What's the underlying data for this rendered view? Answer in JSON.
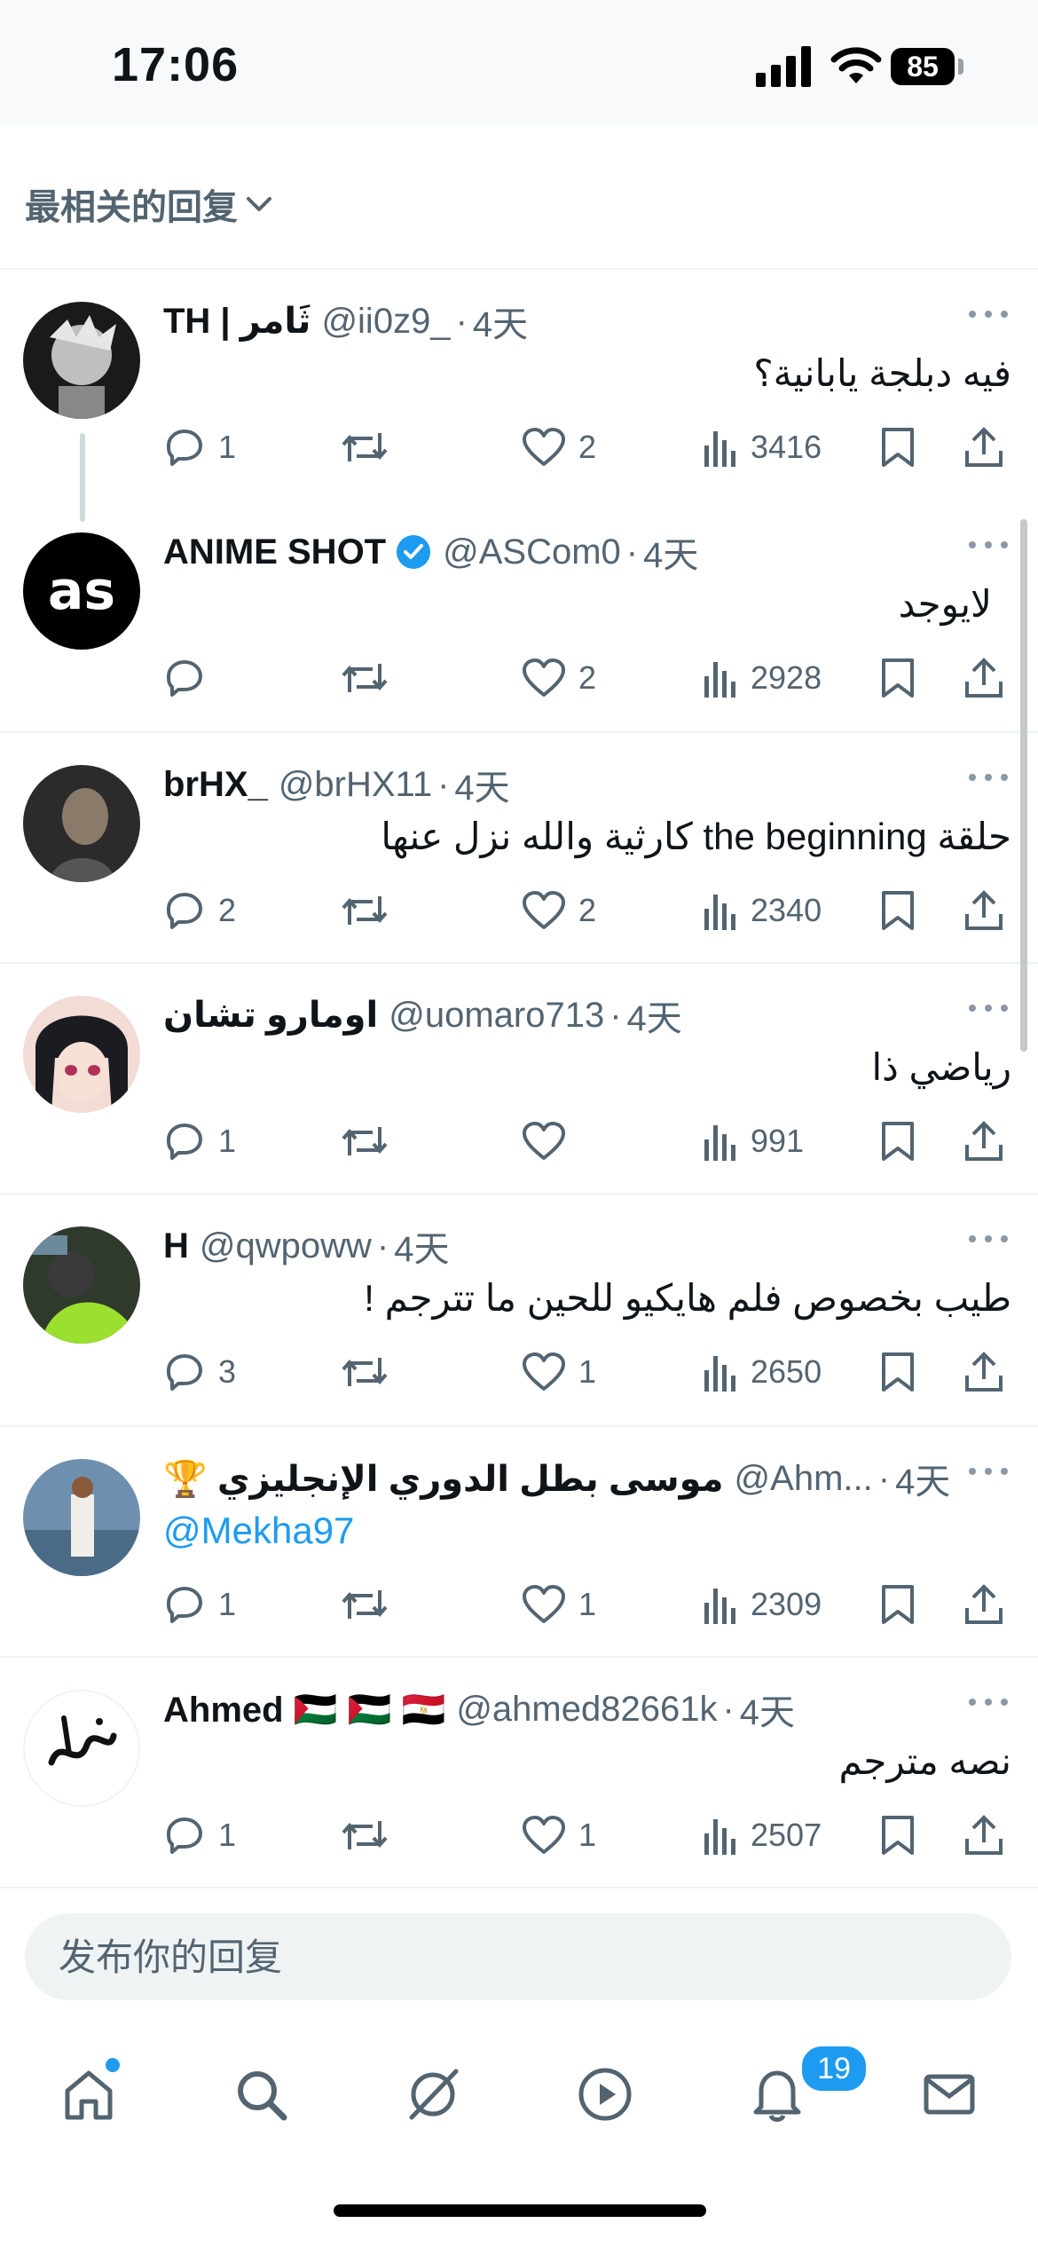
{
  "status_bar": {
    "time": "17:06",
    "battery": "85"
  },
  "sort": {
    "label": "最相关的回复"
  },
  "replies": [
    {
      "name": "TH | ثَامر",
      "handle": "@ii0z9_",
      "time": "4天",
      "text": "فيه دبلجة يابانية؟",
      "replies": "1",
      "retweets": "",
      "likes": "2",
      "views": "3416"
    },
    {
      "name": "ANIME SHOT",
      "verified": true,
      "handle": "@ASCom0",
      "time": "4天",
      "text": "لايوجد",
      "replies": "",
      "retweets": "",
      "likes": "2",
      "views": "2928"
    },
    {
      "name": "brHX_",
      "handle": "@brHX11",
      "time": "4天",
      "text": "حلقة the beginning كارثية والله نزل عنها",
      "replies": "2",
      "retweets": "",
      "likes": "2",
      "views": "2340"
    },
    {
      "name": "اومارو تشان",
      "handle": "@uomaro713",
      "time": "4天",
      "text": "رياضي ذا",
      "replies": "1",
      "retweets": "",
      "likes": "",
      "views": "991"
    },
    {
      "name": "H",
      "handle": "@qwpoww",
      "time": "4天",
      "text": "طيب بخصوص فلم هايكيو للحين ما تترجم !",
      "replies": "3",
      "retweets": "",
      "likes": "1",
      "views": "2650"
    },
    {
      "name": "🏆 موسى بطل الدوري الإنجليزي",
      "handle": "@Ahm...",
      "time": "4天",
      "text": "@Mekha97",
      "replies": "1",
      "retweets": "",
      "likes": "1",
      "views": "2309"
    },
    {
      "name": "Ahmed 🇵🇸 🇵🇸 🇪🇬",
      "handle": "@ahmed82661k",
      "time": "4天",
      "text": "نصه مترجم",
      "replies": "1",
      "retweets": "",
      "likes": "1",
      "views": "2507"
    }
  ],
  "compose": {
    "placeholder": "发布你的回复"
  },
  "tabbar": {
    "notifications_badge": "19"
  },
  "colors": {
    "accent": "#1d9bf0",
    "muted": "#536471",
    "text": "#0f1419"
  },
  "icons": [
    "home-icon",
    "search-icon",
    "grok-icon",
    "video-play-icon",
    "bell-icon",
    "mail-icon",
    "reply-icon",
    "retweet-icon",
    "heart-icon",
    "views-icon",
    "bookmark-icon",
    "share-icon",
    "verified-icon",
    "more-icon"
  ]
}
